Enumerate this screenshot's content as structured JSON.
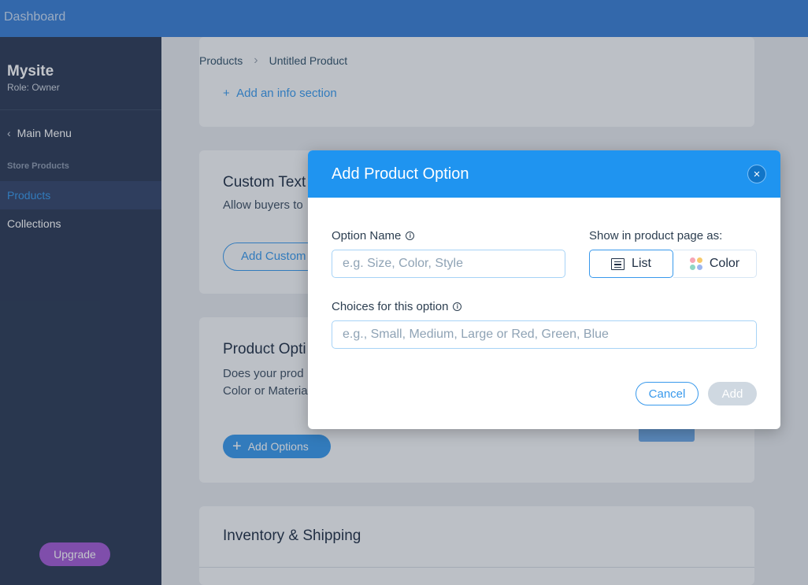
{
  "topbar": {
    "title": "Dashboard"
  },
  "sidebar": {
    "site_name": "Mysite",
    "role": "Role: Owner",
    "main_menu": "Main Menu",
    "section": "Store Products",
    "items": [
      {
        "label": "Products",
        "active": true
      },
      {
        "label": "Collections",
        "active": false
      }
    ],
    "upgrade": "Upgrade"
  },
  "breadcrumb": {
    "root": "Products",
    "current": "Untitled Product"
  },
  "info_card": {
    "add_link": "Add an info section"
  },
  "custom_text_card": {
    "title": "Custom Text",
    "desc": "Allow buyers to",
    "button": "Add Custom"
  },
  "options_card": {
    "title": "Product Opti",
    "desc_line1": "Does your prod",
    "desc_line2": "Color or Materia",
    "button": "Add Options"
  },
  "inventory_card": {
    "title": "Inventory & Shipping"
  },
  "modal": {
    "title": "Add Product Option",
    "close": "×",
    "option_name_label": "Option Name",
    "option_name_placeholder": "e.g. Size, Color, Style",
    "show_as_label": "Show in product page as:",
    "list_label": "List",
    "color_label": "Color",
    "selected_display": "List",
    "choices_label": "Choices for this option",
    "choices_placeholder": "e.g., Small, Medium, Large or Red, Green, Blue",
    "cancel": "Cancel",
    "add": "Add",
    "dot_colors": [
      "#f6a6b5",
      "#f7c96a",
      "#8fd6c4",
      "#9cb6f0"
    ]
  }
}
